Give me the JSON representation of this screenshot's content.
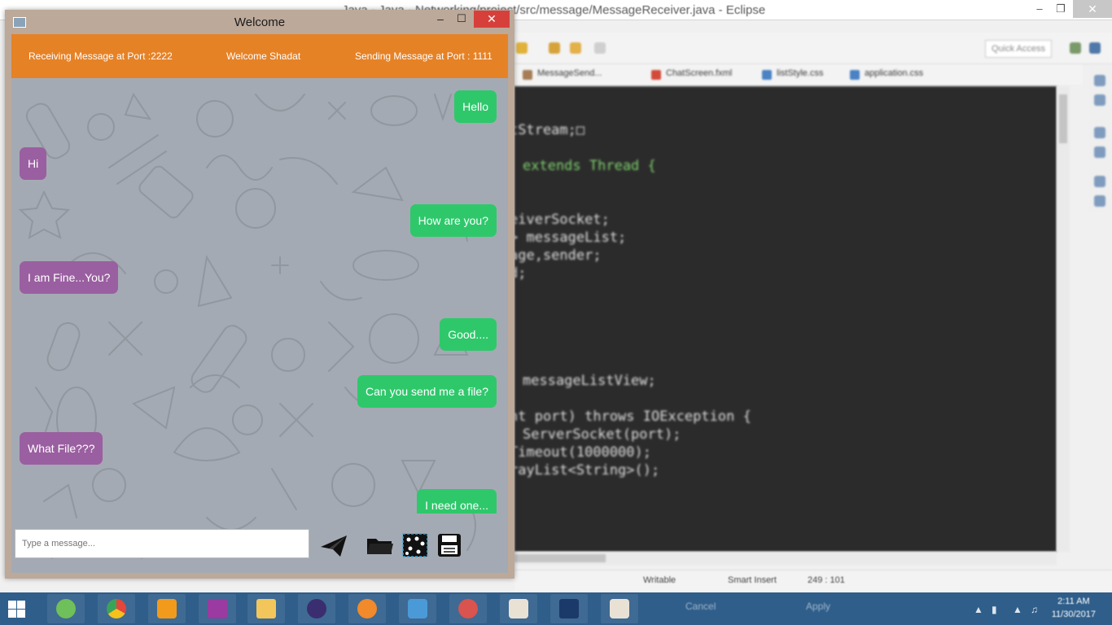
{
  "eclipse": {
    "title": "Java - Java - Networking/project/src/message/MessageReceiver.java - Eclipse",
    "quick_access": "Quick Access",
    "tabs": [
      "MessageSend...",
      "ChatScreen.fxml",
      "listStyle.css",
      "application.css"
    ],
    "code": [
      "tStream;□",
      "extends Thread {",
      "eiverSocket;",
      "> messageList;",
      "age,sender;",
      "d;",
      "messageListView;",
      "nt port) throws IOException {",
      "ServerSocket(port);",
      "Timeout(1000000);",
      "rayList<String>();"
    ],
    "status": {
      "writable": "Writable",
      "insert": "Smart Insert",
      "position": "249 : 101"
    }
  },
  "taskbar": {
    "hidden_labels": [
      "Cancel",
      "Apply"
    ],
    "time": "2:11 AM",
    "date": "11/30/2017"
  },
  "chat": {
    "window_title": "Welcome",
    "header": {
      "receiving": "Receiving Message at Port :2222",
      "welcome": "Welcome Shadat",
      "sending": "Sending Message at Port : 1111"
    },
    "messages": [
      {
        "side": "sent",
        "text": "Hello"
      },
      {
        "side": "recv",
        "text": "Hi"
      },
      {
        "side": "sent",
        "text": "How are you?"
      },
      {
        "side": "recv",
        "text": "I am Fine...You?"
      },
      {
        "side": "sent",
        "text": "Good...."
      },
      {
        "side": "sent",
        "text": "Can you send me a file?"
      },
      {
        "side": "recv",
        "text": "What File???"
      },
      {
        "side": "sent",
        "text": "I need one..."
      }
    ],
    "composer_placeholder": "Type a message...",
    "actions": [
      "send-icon",
      "folder-icon",
      "image-icon",
      "save-icon"
    ]
  },
  "colors": {
    "header": "#e68226",
    "sent": "#2ec86b",
    "recv": "#9a5fa0",
    "close": "#d7403a"
  }
}
